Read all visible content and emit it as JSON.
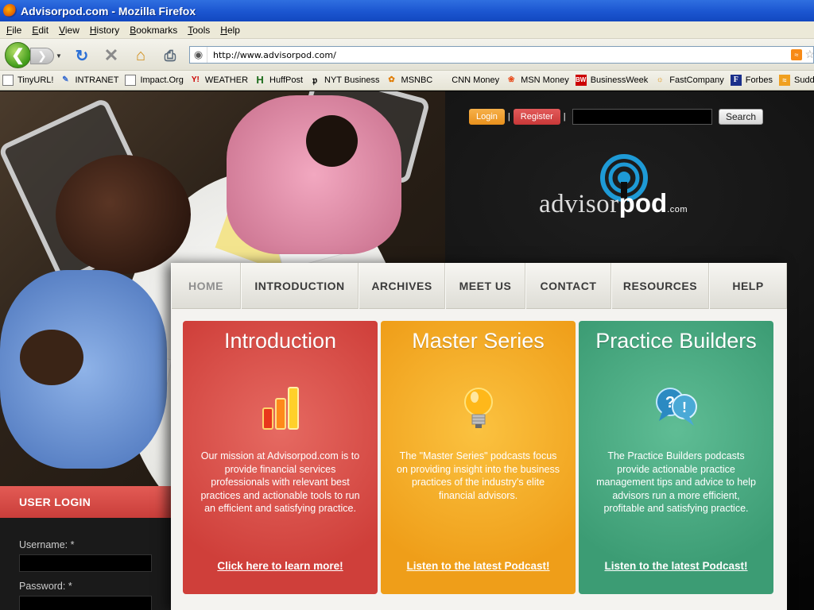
{
  "window": {
    "title": "Advisorpod.com - Mozilla Firefox"
  },
  "menubar": [
    "File",
    "Edit",
    "View",
    "History",
    "Bookmarks",
    "Tools",
    "Help"
  ],
  "addressbar": {
    "url": "http://www.advisorpod.com/"
  },
  "bookmarks": [
    {
      "label": "TinyURL!",
      "icon": "page-icon"
    },
    {
      "label": "INTRANET",
      "icon": "intranet-icon"
    },
    {
      "label": "Impact.Org",
      "icon": "page-icon"
    },
    {
      "label": "WEATHER",
      "icon": "weather-icon"
    },
    {
      "label": "HuffPost",
      "icon": "huffpost-icon"
    },
    {
      "label": "NYT Business",
      "icon": "nyt-icon"
    },
    {
      "label": "MSNBC",
      "icon": "msnbc-icon"
    },
    {
      "label": "CNN Money",
      "icon": "cnn-icon"
    },
    {
      "label": "MSN Money",
      "icon": "msn-icon"
    },
    {
      "label": "BusinessWeek",
      "icon": "bw-icon"
    },
    {
      "label": "FastCompany",
      "icon": "fastcompany-icon"
    },
    {
      "label": "Forbes",
      "icon": "forbes-icon"
    },
    {
      "label": "Sudde",
      "icon": "rss-icon"
    }
  ],
  "header": {
    "login_label": "Login",
    "register_label": "Register",
    "separator": "|",
    "search_label": "Search",
    "logo_part1": "advisor",
    "logo_part2": "pod",
    "logo_part3": ".com"
  },
  "nav": [
    {
      "label": "HOME"
    },
    {
      "label": "INTRODUCTION"
    },
    {
      "label": "ARCHIVES"
    },
    {
      "label": "MEET US"
    },
    {
      "label": "CONTACT"
    },
    {
      "label": "RESOURCES"
    },
    {
      "label": "HELP"
    }
  ],
  "cards": [
    {
      "title": "Introduction",
      "icon": "bar-chart-icon",
      "text": "Our mission at Advisorpod.com is to provide financial services professionals with relevant best practices and actionable tools to run an efficient and satisfying practice.",
      "link": "Click here to learn more!"
    },
    {
      "title": "Master Series",
      "icon": "lightbulb-icon",
      "text": "The \"Master Series\" podcasts focus on providing insight into the business practices of the industry's elite financial advisors.",
      "link": "Listen to the latest Podcast!"
    },
    {
      "title": "Practice Builders",
      "icon": "speech-bubbles-icon",
      "text": "The Practice Builders podcasts provide actionable practice management tips and advice to help advisors run a more efficient, profitable and satisfying practice.",
      "link": "Listen to the latest Podcast!"
    }
  ],
  "user_login": {
    "heading": "USER LOGIN",
    "username_label": "Username: *",
    "password_label": "Password: *"
  },
  "colors": {
    "titlebar": "#1b55d0",
    "card_red": "#cf3f3a",
    "card_orange": "#ef9e19",
    "card_green": "#3c9c74",
    "login_orange": "#e8901c",
    "register_red": "#c83838"
  }
}
